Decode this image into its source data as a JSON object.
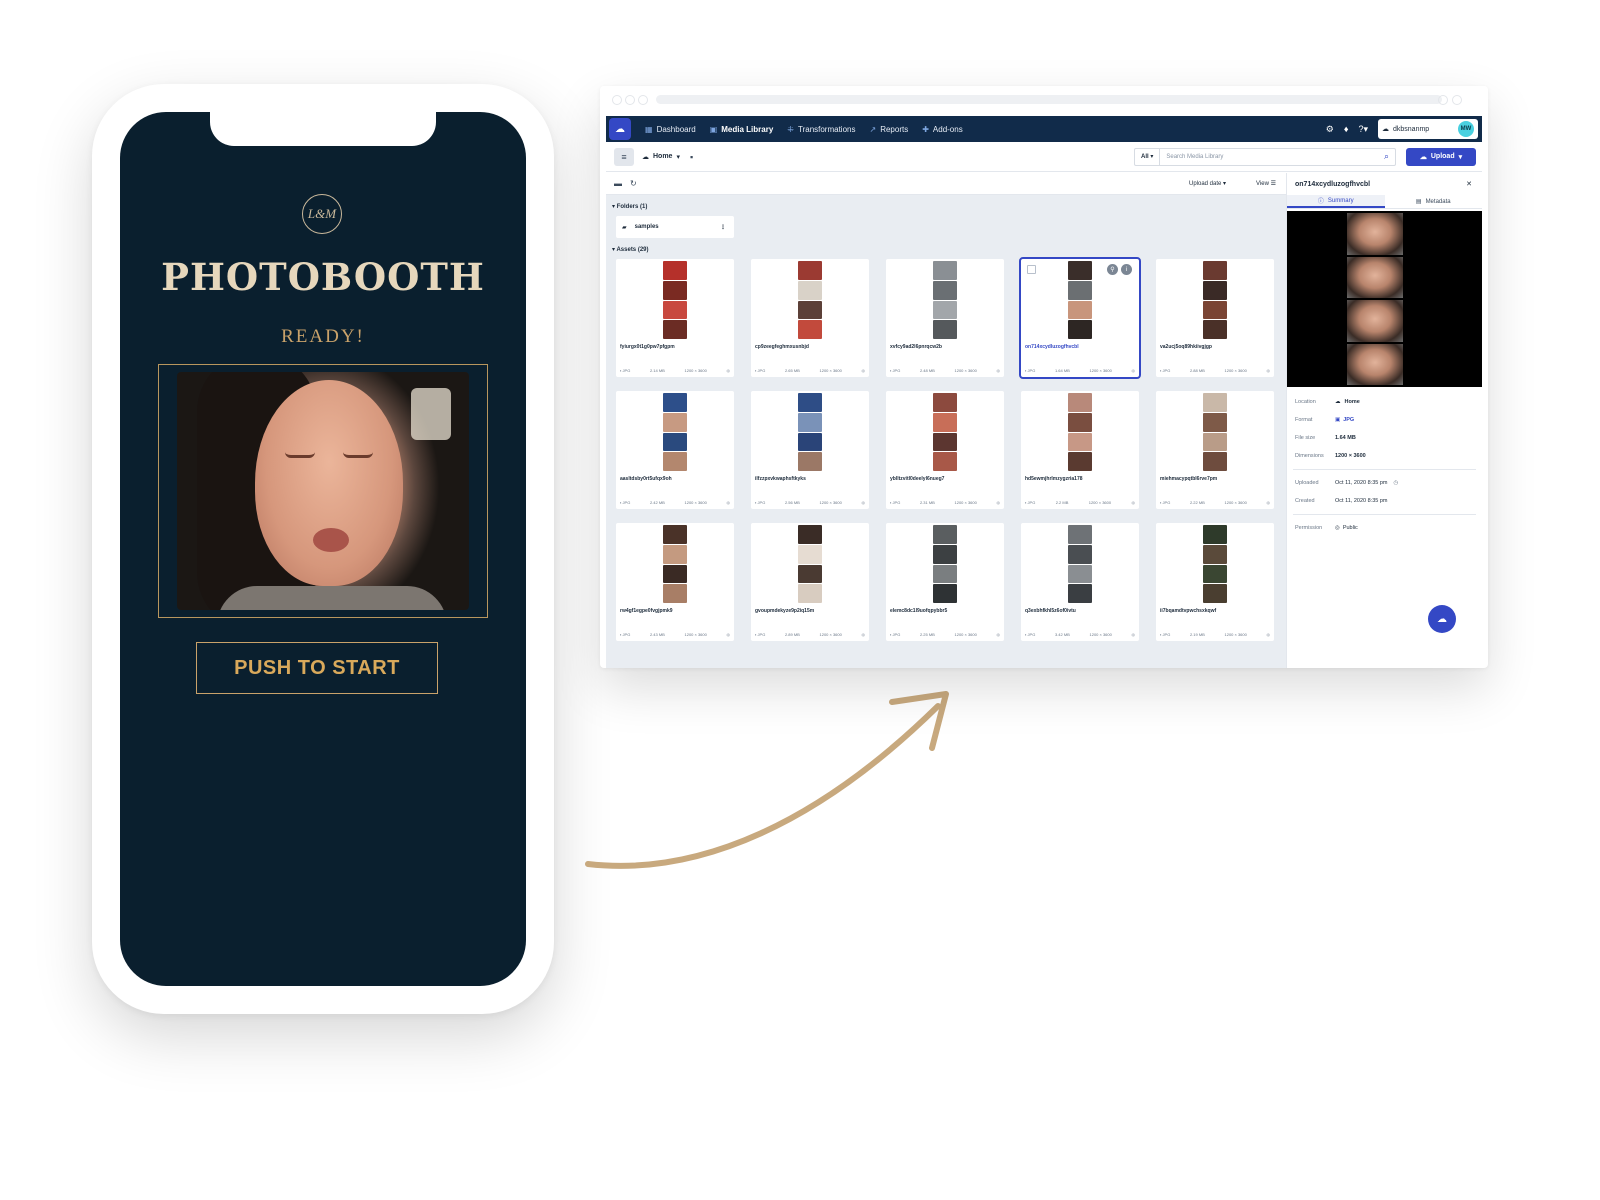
{
  "phone": {
    "logo_text": "L&M",
    "title": "PHOTOBOOTH",
    "status": "READY!",
    "start_button": "PUSH TO START"
  },
  "nav": {
    "dashboard": "Dashboard",
    "media_library": "Media Library",
    "transformations": "Transformations",
    "reports": "Reports",
    "addons": "Add-ons",
    "account": "dkbsnanmp",
    "avatar": "MW"
  },
  "toolbar": {
    "home": "Home",
    "filter_all": "All",
    "search_placeholder": "Search Media Library",
    "upload": "Upload"
  },
  "main": {
    "sort_label": "Upload date",
    "view_label": "View",
    "folders_label": "Folders (1)",
    "folder_name": "samples",
    "assets_label": "Assets (29)",
    "assets": [
      {
        "name": "fyiurgx0t1g0pw7pfgpm",
        "format": "JPG",
        "size": "2.14 MB",
        "dims": "1200 × 3600"
      },
      {
        "name": "cp9zeegfeghmxusnbjd",
        "format": "JPG",
        "size": "2.65 MB",
        "dims": "1200 × 3600"
      },
      {
        "name": "xvfcy9ad2l6pnrqcw2b",
        "format": "JPG",
        "size": "2.48 MB",
        "dims": "1200 × 3600"
      },
      {
        "name": "on714xcydluzogfhvcbl",
        "format": "JPG",
        "size": "1.64 MB",
        "dims": "1200 × 3600"
      },
      {
        "name": "va2ucj5oq89hkiivgjgp",
        "format": "JPG",
        "size": "2.88 MB",
        "dims": "1200 × 3600"
      },
      {
        "name": "aasltdsby0rt5ufqx9oh",
        "format": "JPG",
        "size": "2.42 MB",
        "dims": "1200 × 3600"
      },
      {
        "name": "ilfzzpxvkwaphsftkyks",
        "format": "JPG",
        "size": "2.56 MB",
        "dims": "1200 × 3600"
      },
      {
        "name": "yblltzvitl0deelyl6nueg7",
        "format": "JPG",
        "size": "2.31 MB",
        "dims": "1200 × 3600"
      },
      {
        "name": "hd5ewmjhrlmzygzria178",
        "format": "JPG",
        "size": "2.2 MB",
        "dims": "1200 × 3600"
      },
      {
        "name": "miehmacypqtbl6rve7pm",
        "format": "JPG",
        "size": "2.22 MB",
        "dims": "1200 × 3600"
      },
      {
        "name": "rw4gf1egpe0fvgjpmk9",
        "format": "JPG",
        "size": "2.43 MB",
        "dims": "1200 × 3600"
      },
      {
        "name": "gvoupmdekyze9p2iq15m",
        "format": "JPG",
        "size": "2.89 MB",
        "dims": "1200 × 3600"
      },
      {
        "name": "elemc8dc1l9uofqpybbr5",
        "format": "JPG",
        "size": "2.25 MB",
        "dims": "1200 × 3600"
      },
      {
        "name": "q3exbhfkhl5z6of0ivtu",
        "format": "JPG",
        "size": "3.42 MB",
        "dims": "1200 × 3600"
      },
      {
        "name": "ii7bqamdtvpwchsxkqwf",
        "format": "JPG",
        "size": "2.19 MB",
        "dims": "1200 × 3600"
      }
    ]
  },
  "details": {
    "asset_name": "on714xcydluzogfhvcbl",
    "tab_summary": "Summary",
    "tab_metadata": "Metadata",
    "location_label": "Location",
    "location": "Home",
    "format_label": "Format",
    "format": "JPG",
    "filesize_label": "File size",
    "filesize": "1.64 MB",
    "dimensions_label": "Dimensions",
    "dimensions": "1200 × 3600",
    "uploaded_label": "Uploaded",
    "uploaded": "Oct 11, 2020 8:35 pm",
    "created_label": "Created",
    "created": "Oct 11, 2020 8:35 pm",
    "permission_label": "Permission",
    "permission": "Public"
  },
  "colors": {
    "phone_bg": "#0a1f2e",
    "gold": "#c9a26a",
    "brand_blue": "#3448c5",
    "nav_bg": "#112b4a",
    "arrow": "#c8a97e"
  }
}
